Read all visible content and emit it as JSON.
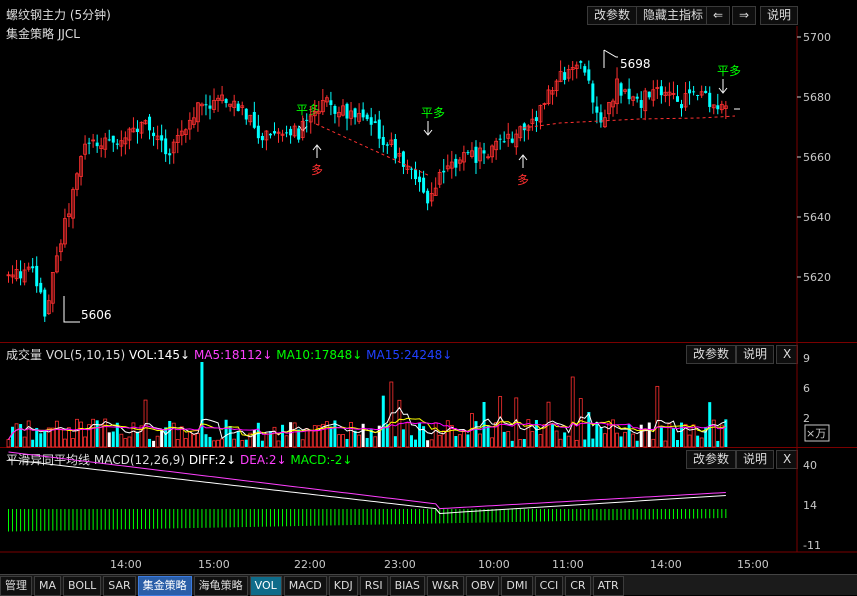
{
  "main_panel": {
    "title": "螺纹钢主力 (5分钟)",
    "strategy": "集金策略 JJCL",
    "buttons": [
      "改参数",
      "隐藏主指标",
      "⇐",
      "⇒",
      "说明"
    ],
    "price_axis": [
      "5700",
      "5680",
      "5660",
      "5640",
      "5620"
    ],
    "high_label": "5698",
    "low_label": "5606",
    "signals": [
      {
        "text": "平多",
        "color": "#00ff00",
        "dir": "down"
      },
      {
        "text": "多",
        "color": "#ff3030",
        "dir": "up"
      },
      {
        "text": "平多",
        "color": "#00ff00",
        "dir": "down"
      },
      {
        "text": "多",
        "color": "#ff3030",
        "dir": "up"
      },
      {
        "text": "平多",
        "color": "#00ff00",
        "dir": "down"
      }
    ]
  },
  "volume_panel": {
    "name": "成交量",
    "params": "VOL(5,10,15)",
    "vol": "VOL:145↓",
    "ma5": "MA5:18112↓",
    "ma10": "MA10:17848↓",
    "ma15": "MA15:24248↓",
    "buttons": [
      "改参数",
      "说明",
      "X"
    ],
    "axis": [
      "9",
      "6",
      "2"
    ],
    "unit": "×万"
  },
  "macd_panel": {
    "name": "平滑异同平均线",
    "params": "MACD(12,26,9)",
    "diff": "DIFF:2↓",
    "dea": "DEA:2↓",
    "macd": "MACD:-2↓",
    "buttons": [
      "改参数",
      "说明",
      "X"
    ],
    "axis": [
      "40",
      "14",
      "-11"
    ]
  },
  "time_axis": [
    "14:00",
    "15:00",
    "22:00",
    "23:00",
    "10:00",
    "11:00",
    "14:00",
    "15:00"
  ],
  "tabs": [
    "管理",
    "MA",
    "BOLL",
    "SAR",
    "集金策略",
    "海龟策略",
    "VOL",
    "MACD",
    "KDJ",
    "RSI",
    "BIAS",
    "W&R",
    "OBV",
    "DMI",
    "CCI",
    "CR",
    "ATR"
  ],
  "active_tabs": [
    "集金策略",
    "VOL"
  ],
  "colors": {
    "up": "#ff3030",
    "down": "#00ffff",
    "ma5": "#ffffff",
    "ma10": "#ffff00",
    "ma15": "#ff00ff",
    "dea": "#ff40ff",
    "macd": "#00ff00",
    "grid": "#7a0000"
  }
}
